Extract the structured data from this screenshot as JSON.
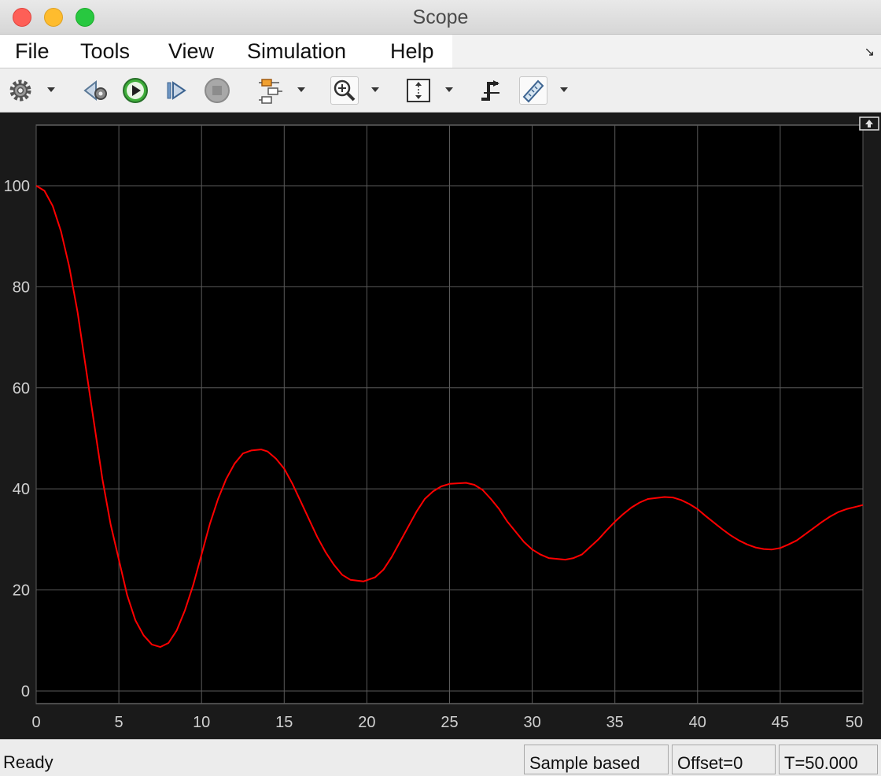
{
  "window": {
    "title": "Scope"
  },
  "menu": [
    {
      "label": "File"
    },
    {
      "label": "Tools"
    },
    {
      "label": "View"
    },
    {
      "label": "Simulation"
    },
    {
      "label": "Help"
    }
  ],
  "toolbar": {
    "icons": [
      "gear-icon",
      "step-back-icon",
      "run-icon",
      "step-forward-icon",
      "stop-icon",
      "signal-hierarchy-icon",
      "zoom-in-icon",
      "autoscale-icon",
      "triggers-icon",
      "measurements-icon"
    ]
  },
  "status": {
    "ready": "Ready",
    "mode": "Sample based",
    "offset": "Offset=0",
    "time": "T=50.000"
  },
  "chart_data": {
    "type": "line",
    "xlim": [
      0,
      50
    ],
    "ylim": [
      -2.5,
      112
    ],
    "xticks": [
      0,
      5,
      10,
      15,
      20,
      25,
      30,
      35,
      40,
      45,
      50
    ],
    "yticks": [
      0,
      20,
      40,
      60,
      80,
      100
    ],
    "grid": true,
    "background": "#000000",
    "grid_color": "#5a5a5a",
    "series": [
      {
        "color": "#ff0000",
        "points": [
          [
            0,
            100
          ],
          [
            0.5,
            99
          ],
          [
            1,
            96
          ],
          [
            1.5,
            91
          ],
          [
            2,
            84
          ],
          [
            2.5,
            75
          ],
          [
            3,
            64
          ],
          [
            3.5,
            53
          ],
          [
            4,
            42
          ],
          [
            4.5,
            33
          ],
          [
            5,
            26
          ],
          [
            5.5,
            19
          ],
          [
            6,
            14
          ],
          [
            6.5,
            11
          ],
          [
            7,
            9.2
          ],
          [
            7.5,
            8.7
          ],
          [
            8,
            9.5
          ],
          [
            8.5,
            12
          ],
          [
            9,
            16
          ],
          [
            9.5,
            21
          ],
          [
            10,
            27
          ],
          [
            10.5,
            33
          ],
          [
            11,
            38
          ],
          [
            11.5,
            42
          ],
          [
            12,
            45
          ],
          [
            12.5,
            47
          ],
          [
            13,
            47.6
          ],
          [
            13.6,
            47.8
          ],
          [
            14,
            47.4
          ],
          [
            14.5,
            46
          ],
          [
            15,
            44
          ],
          [
            15.5,
            41
          ],
          [
            16,
            37.5
          ],
          [
            16.5,
            34
          ],
          [
            17,
            30.5
          ],
          [
            17.5,
            27.5
          ],
          [
            18,
            25
          ],
          [
            18.5,
            23
          ],
          [
            19,
            22
          ],
          [
            19.8,
            21.7
          ],
          [
            20.5,
            22.5
          ],
          [
            21,
            24
          ],
          [
            21.5,
            26.5
          ],
          [
            22,
            29.5
          ],
          [
            22.5,
            32.5
          ],
          [
            23,
            35.5
          ],
          [
            23.5,
            38
          ],
          [
            24,
            39.5
          ],
          [
            24.5,
            40.5
          ],
          [
            25,
            41
          ],
          [
            26,
            41.2
          ],
          [
            26.5,
            40.8
          ],
          [
            27,
            39.8
          ],
          [
            27.5,
            38
          ],
          [
            28,
            36
          ],
          [
            28.5,
            33.5
          ],
          [
            29,
            31.5
          ],
          [
            29.5,
            29.5
          ],
          [
            30,
            28
          ],
          [
            30.5,
            27
          ],
          [
            31,
            26.3
          ],
          [
            32,
            26
          ],
          [
            32.5,
            26.3
          ],
          [
            33,
            27
          ],
          [
            33.5,
            28.5
          ],
          [
            34,
            30
          ],
          [
            34.5,
            31.8
          ],
          [
            35,
            33.5
          ],
          [
            35.5,
            35
          ],
          [
            36,
            36.3
          ],
          [
            36.5,
            37.3
          ],
          [
            37,
            38
          ],
          [
            38,
            38.4
          ],
          [
            38.5,
            38.3
          ],
          [
            39,
            37.8
          ],
          [
            39.5,
            37
          ],
          [
            40,
            36
          ],
          [
            40.5,
            34.6
          ],
          [
            41,
            33.3
          ],
          [
            41.5,
            32
          ],
          [
            42,
            30.8
          ],
          [
            42.5,
            29.8
          ],
          [
            43,
            29
          ],
          [
            43.5,
            28.4
          ],
          [
            44,
            28.1
          ],
          [
            44.5,
            28
          ],
          [
            45,
            28.3
          ],
          [
            45.5,
            29
          ],
          [
            46,
            29.8
          ],
          [
            46.5,
            31
          ],
          [
            47,
            32.2
          ],
          [
            47.5,
            33.4
          ],
          [
            48,
            34.5
          ],
          [
            48.5,
            35.4
          ],
          [
            49,
            36
          ],
          [
            49.5,
            36.4
          ],
          [
            50,
            36.8
          ]
        ]
      }
    ]
  }
}
